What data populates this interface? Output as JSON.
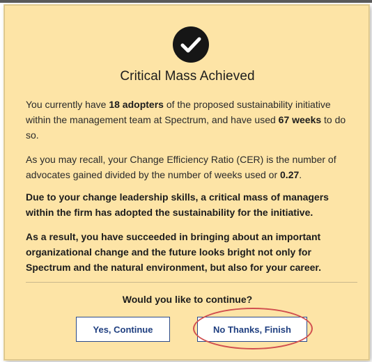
{
  "dialog": {
    "icon": "checkmark-circle-icon",
    "title": "Critical Mass Achieved",
    "paragraph1": {
      "text_a": "You currently have ",
      "adopters": "18 adopters",
      "text_b": " of the proposed sustainability initiative within the management team at Spectrum, and have used ",
      "weeks": "67 weeks",
      "text_c": " to do so."
    },
    "paragraph2": {
      "text_a": "As you may recall, your Change Efficiency Ratio (CER) is the number of advocates gained divided by the number of weeks used or ",
      "ratio": "0.27",
      "text_b": "."
    },
    "paragraph3": "Due to your change leadership skills, a critical mass of managers within the firm has adopted the sustainability for the initiative.",
    "paragraph4": "As a result, you have succeeded in bringing about an important organizational change and the future looks bright not only for Spectrum and the natural environment, but also for your career.",
    "question": "Would you like to continue?",
    "buttons": {
      "continue_label": "Yes, Continue",
      "finish_label": "No Thanks, Finish"
    }
  },
  "colors": {
    "dialog_background": "#fde4a6",
    "button_text": "#1f3f80",
    "highlight": "#d14f4f"
  }
}
